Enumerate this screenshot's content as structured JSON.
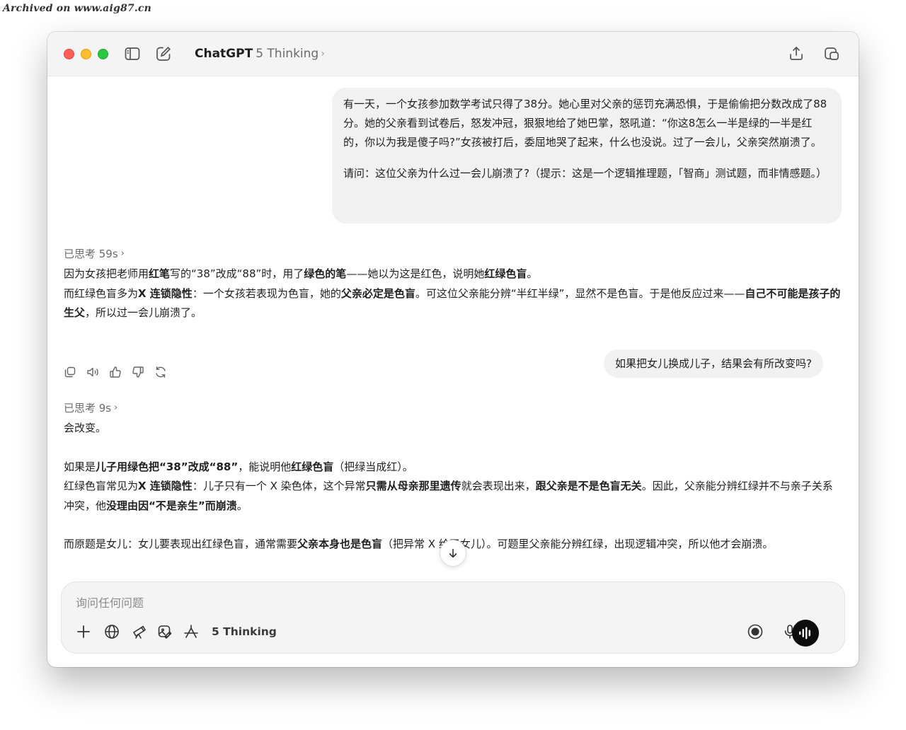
{
  "watermark": "Archived on www.aig87.cn",
  "app": {
    "name": "ChatGPT",
    "model": "5 Thinking",
    "chevron": "›"
  },
  "conversation": {
    "user_message_1": {
      "para1": "有一天，一个女孩参加数学考试只得了38分。她心里对父亲的惩罚充满恐惧，于是偷偷把分数改成了88分。她的父亲看到试卷后，怒发冲冠，狠狠地给了她巴掌，怒吼道：“你这8怎么一半是绿的一半是红的，你以为我是傻子吗?”女孩被打后，委屈地哭了起来，什么也没说。过了一会儿，父亲突然崩溃了。",
      "para2": "请问：这位父亲为什么过一会儿崩溃了?（提示：这是一个逻辑推理题，「智商」测试题，而非情感题。）"
    },
    "thought_1": "已思考 59s",
    "answer_1": {
      "l1_a": "因为女孩把老师用",
      "l1_b": "红笔",
      "l1_c": "写的“38”改成“88”时，用了",
      "l1_d": "绿色的笔",
      "l1_e": "——她以为这是红色，说明她",
      "l1_f": "红绿色盲",
      "l1_g": "。",
      "l2_a": "而红绿色盲多为",
      "l2_b": "X 连锁隐性",
      "l2_c": "：一个女孩若表现为色盲，她的",
      "l2_d": "父亲必定是色盲",
      "l2_e": "。可这位父亲能分辨“半红半绿”，显然不是色盲。于是他反应过来——",
      "l2_f": "自己不可能是孩子的生父",
      "l2_g": "，所以过一会儿崩溃了。"
    },
    "user_message_2": "如果把女儿换成儿子，结果会有所改变吗?",
    "thought_2": "已思考 9s",
    "answer_2": {
      "p1": "会改变。",
      "p2_a": "如果是",
      "p2_b": "儿子用绿色把“38”改成“88”",
      "p2_c": "，能说明他",
      "p2_d": "红绿色盲",
      "p2_e": "（把绿当成红）。",
      "p3_a": "红绿色盲常见为",
      "p3_b": "X 连锁隐性",
      "p3_c": "：儿子只有一个 X 染色体，这个异常",
      "p3_d": "只需从母亲那里遗传",
      "p3_e": "就会表现出来，",
      "p3_f": "跟父亲是不是色盲无关",
      "p3_g": "。因此，父亲能分辨红绿并不与亲子关系冲突，他",
      "p3_h": "没理由因“不是亲生”而崩溃",
      "p3_i": "。",
      "p4_a": "而原题是女儿：女儿要表现出红绿色盲，通常需要",
      "p4_b": "父亲本身也是色盲",
      "p4_c": "（把异常 X 给了女儿）。可题里父亲能分辨红绿，出现逻辑冲突，所以他才会崩溃。"
    }
  },
  "composer": {
    "placeholder": "询问任何问题",
    "mode_label": "5 Thinking"
  },
  "icons": {
    "sidebar": "sidebar-icon",
    "new_chat": "compose-icon",
    "share": "share-icon",
    "window": "window-icon",
    "copy": "copy-icon",
    "read_aloud": "speaker-icon",
    "like": "thumbs-up-icon",
    "dislike": "thumbs-down-icon",
    "regenerate": "refresh-icon",
    "plus": "plus-icon",
    "web": "globe-icon",
    "research": "telescope-icon",
    "image": "image-edit-icon",
    "agent": "agent-icon",
    "record": "record-icon",
    "mic": "microphone-icon",
    "voice": "voice-mode-icon",
    "scroll_down": "arrow-down-icon"
  },
  "colors": {
    "close": "#ff5f57",
    "minimize": "#febc2e",
    "zoom": "#28c840",
    "user_bubble": "#f1f1f2",
    "voice_button": "#0d0d0d"
  }
}
